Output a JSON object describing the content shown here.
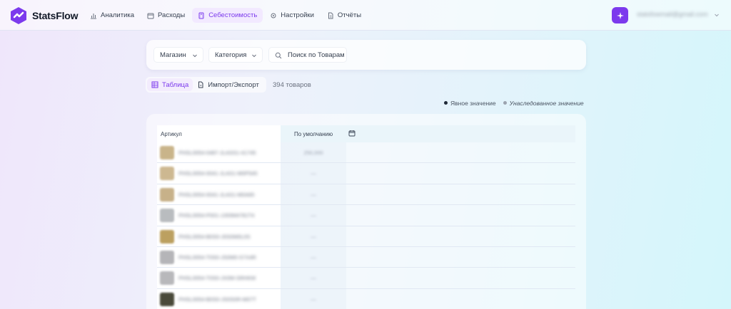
{
  "app": {
    "name": "StatsFlow"
  },
  "nav": {
    "items": [
      {
        "label": "Аналитика",
        "icon": "bar-chart-icon",
        "active": false
      },
      {
        "label": "Расходы",
        "icon": "wallet-icon",
        "active": false
      },
      {
        "label": "Себестоимость",
        "icon": "calculator-icon",
        "active": true
      },
      {
        "label": "Настройки",
        "icon": "gear-icon",
        "active": false
      },
      {
        "label": "Отчёты",
        "icon": "document-icon",
        "active": false
      }
    ]
  },
  "user": {
    "email": "statsfowmail@gmail.com",
    "accent": "#7c3aed"
  },
  "filters": {
    "store": {
      "label": "Магазин"
    },
    "category": {
      "label": "Категория"
    },
    "search": {
      "placeholder": "Поиск по Товарам"
    }
  },
  "tabs": [
    {
      "label": "Таблица",
      "icon": "table-icon",
      "active": true
    },
    {
      "label": "Импорт/Экспорт",
      "icon": "file-icon",
      "active": false
    }
  ],
  "count_label": "394 товаров",
  "legend": {
    "explicit": "Явное значение",
    "inherited": "Унаследованное значение"
  },
  "table": {
    "col_article": "Артикул",
    "col_default": "По умолчанию",
    "rows": [
      {
        "sku": "PHSL0054-0487-JLASS1-41745",
        "value": "250,000",
        "thumb_color": "#c9b48a"
      },
      {
        "sku": "PHSL0054-0041-JLAS1-M0P545",
        "value": "—",
        "thumb_color": "#cdb891"
      },
      {
        "sku": "PHSL0054-0041-JLAS1-M0A65",
        "value": "—",
        "thumb_color": "#c7b189"
      },
      {
        "sku": "PHSL0054-P001-JJ00M4781T4",
        "value": "—",
        "thumb_color": "#b9bcbf"
      },
      {
        "sku": "PHSL0054-B0S0-J0S0M0L0S",
        "value": "—",
        "thumb_color": "#bca060"
      },
      {
        "sku": "PHSL0054-T0S0-JS0M0-S7X4R",
        "value": "—",
        "thumb_color": "#b5b5b8"
      },
      {
        "sku": "PHSL0054-T0S0-JX0M-SRHKM",
        "value": "—",
        "thumb_color": "#b8b8bb"
      },
      {
        "sku": "PHSL0054-B0S0-JS0S0R-M07T",
        "value": "—",
        "thumb_color": "#4a4a3a"
      }
    ]
  }
}
